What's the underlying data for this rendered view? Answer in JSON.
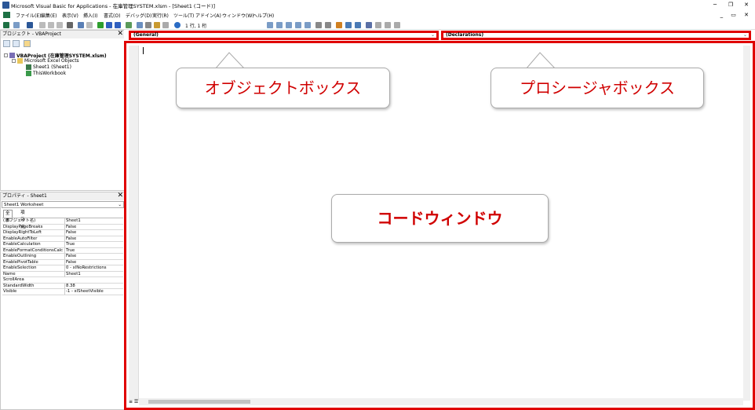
{
  "window": {
    "title": "Microsoft Visual Basic for Applications - 在庫管理SYSTEM.xlsm - [Sheet1 (コード)]",
    "minimize": "─",
    "restore": "❐",
    "close": "✕"
  },
  "menu": {
    "items": [
      "ファイル(E)",
      "編集(E)",
      "表示(V)",
      "挿入(I)",
      "書式(O)",
      "デバッグ(D)",
      "実行(R)",
      "ツール(T)",
      "アドイン(A)",
      "ウィンドウ(W)",
      "ヘルプ(H)"
    ],
    "mdi": "_ ▭ ✕"
  },
  "toolbar": {
    "position": "1 行, 1 桁"
  },
  "project": {
    "title": "プロジェクト - VBAProject",
    "close": "✕",
    "root": "VBAProject (在庫管理SYSTEM.xlsm)",
    "folder": "Microsoft Excel Objects",
    "items": [
      "Sheet1 (Sheet1)",
      "ThisWorkbook"
    ]
  },
  "properties": {
    "title": "プロパティ - Sheet1",
    "close": "✕",
    "selected_object": "Sheet1 Worksheet",
    "tabs": [
      "全体",
      "項目別"
    ],
    "rows": [
      {
        "key": "(オブジェクト名)",
        "value": "Sheet1"
      },
      {
        "key": "DisplayPageBreaks",
        "value": "False"
      },
      {
        "key": "DisplayRightToLeft",
        "value": "False"
      },
      {
        "key": "EnableAutoFilter",
        "value": "False"
      },
      {
        "key": "EnableCalculation",
        "value": "True"
      },
      {
        "key": "EnableFormatConditionsCalcu",
        "value": "True"
      },
      {
        "key": "EnableOutlining",
        "value": "False"
      },
      {
        "key": "EnablePivotTable",
        "value": "False"
      },
      {
        "key": "EnableSelection",
        "value": "0 - xlNoRestrictions"
      },
      {
        "key": "Name",
        "value": "Sheet1"
      },
      {
        "key": "ScrollArea",
        "value": ""
      },
      {
        "key": "StandardWidth",
        "value": "8.38"
      },
      {
        "key": "Visible",
        "value": "-1 - xlSheetVisible"
      }
    ]
  },
  "code": {
    "object_box": "(General)",
    "procedure_box": "(Declarations)",
    "view_buttons": "≡ ☰"
  },
  "callouts": {
    "object_box": "オブジェクトボックス",
    "procedure_box": "プロシージャボックス",
    "code_window": "コードウィンドウ"
  },
  "colors": {
    "highlight_red": "#e00000",
    "callout_text": "#d00000"
  }
}
